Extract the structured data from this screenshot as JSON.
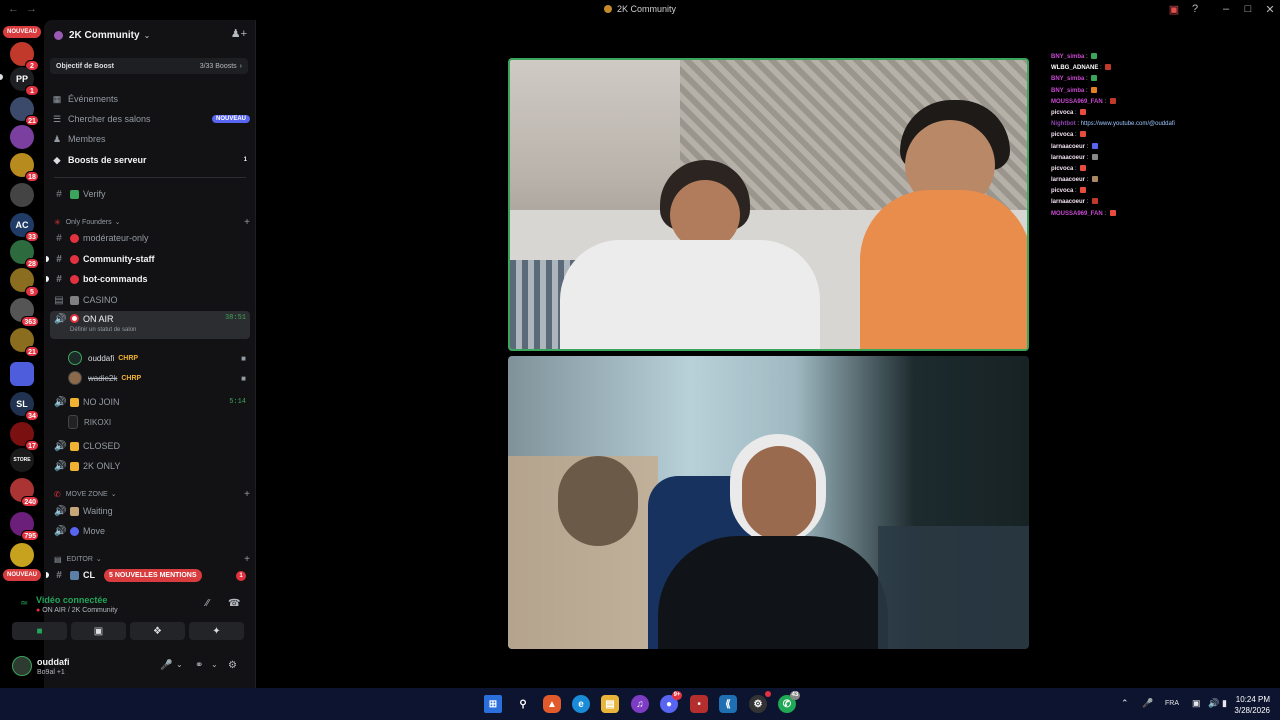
{
  "window": {
    "title": "2K Community"
  },
  "rail": {
    "new_label": "NOUVEAU",
    "servers": [
      {
        "label": "",
        "badge": "2",
        "color": "#c0392b"
      },
      {
        "label": "PP",
        "badge": "1",
        "color": "#1e1f22"
      },
      {
        "label": "",
        "badge": "21",
        "color": "#3b4a6b"
      },
      {
        "label": "",
        "badge": "",
        "color": "#7b3fa0"
      },
      {
        "label": "",
        "badge": "18",
        "color": "#b88b1e"
      },
      {
        "label": "",
        "badge": "",
        "color": "#444"
      },
      {
        "label": "AC",
        "badge": "33",
        "color": "#1f3b66"
      },
      {
        "label": "",
        "badge": "28",
        "color": "#2d6a3e"
      },
      {
        "label": "",
        "badge": "5",
        "color": "#8a6d1f"
      },
      {
        "label": "",
        "badge": "363",
        "color": "#555"
      },
      {
        "label": "",
        "badge": "21",
        "color": "#8a6d1f"
      },
      {
        "label": "",
        "badge": "",
        "color": "#4e5ddb"
      },
      {
        "label": "SL",
        "badge": "34",
        "color": "#20324f"
      },
      {
        "label": "",
        "badge": "17",
        "color": "#7a1010"
      },
      {
        "label": "STORE",
        "badge": "",
        "color": "#1a1a1a"
      },
      {
        "label": "",
        "badge": "240",
        "color": "#a33"
      },
      {
        "label": "",
        "badge": "795",
        "color": "#6b1f7a"
      },
      {
        "label": "",
        "badge": "",
        "color": "#c7a21e"
      }
    ]
  },
  "sidebar": {
    "server_name": "2K Community",
    "boost_goal": "Objectif de Boost",
    "boost_count": "3/33 Boosts",
    "menu": [
      {
        "label": "Événements",
        "icon": "calendar-icon"
      },
      {
        "label": "Chercher des salons",
        "icon": "search-channels-icon",
        "pill": "NOUVEAU"
      },
      {
        "label": "Membres",
        "icon": "members-icon"
      },
      {
        "label": "Boosts de serveur",
        "icon": "boost-icon",
        "count": "1"
      }
    ],
    "verify": "Verify",
    "cat_founders": "Only Founders",
    "ch_moderator": "modérateur-only",
    "ch_staff": "Community-staff",
    "ch_bot": "bot-commands",
    "ch_casino": "CASINO",
    "ch_onair": "ON AIR",
    "onair_timer": "38:51",
    "onair_sub": "Définir un statut de salon",
    "user1": "ouddafi",
    "user1_tag": "CHRP",
    "user2": "wadie2k",
    "user2_tag": "CHRP",
    "ch_nojoin": "NO JOIN",
    "nojoin_timer": "5:14",
    "user3": "RIKOXI",
    "ch_closed": "CLOSED",
    "ch_2konly": "2K ONLY",
    "cat_move": "MOVE ZONE",
    "ch_waiting": "Waiting",
    "ch_move": "Move",
    "cat_editor": "EDITOR",
    "ch_cl": "CL",
    "mentions": "5 NOUVELLES MENTIONS",
    "mentions_count": "1"
  },
  "voice": {
    "status": "Vidéo connectée",
    "location": "ON AIR / 2K Community"
  },
  "user": {
    "name": "ouddafi",
    "status": "Bo9al +1"
  },
  "chat": [
    {
      "author": "BNY_simba",
      "text": "",
      "color": "#c94bd1",
      "emote": "#3ba55c"
    },
    {
      "author": "WLBG_ADNANE",
      "text": "",
      "color": "#ffffff",
      "emote": "#c0392b"
    },
    {
      "author": "BNY_simba",
      "text": "",
      "color": "#c94bd1",
      "emote": "#3ba55c"
    },
    {
      "author": "BNY_simba",
      "text": "",
      "color": "#c94bd1",
      "emote": "#e67e22"
    },
    {
      "author": "MOUSSA969_FAN",
      "text": "",
      "color": "#c94bd1",
      "emote": "#c0392b"
    },
    {
      "author": "picvoca",
      "text": "",
      "color": "#f0e0f0",
      "emote": "#e74c3c"
    },
    {
      "author": "Nightbot",
      "text": "https://www.youtube.com/@ouddafi",
      "color": "#8e44ad",
      "emote": ""
    },
    {
      "author": "picvoca",
      "text": "",
      "color": "#f0e0f0",
      "emote": "#e74c3c"
    },
    {
      "author": "larnaacoeur",
      "text": "",
      "color": "#f0e0f0",
      "emote": "#5865f2"
    },
    {
      "author": "larnaacoeur",
      "text": "",
      "color": "#f0e0f0",
      "emote": "#888888"
    },
    {
      "author": "picvoca",
      "text": "",
      "color": "#f0e0f0",
      "emote": "#e74c3c"
    },
    {
      "author": "larnaacoeur",
      "text": "",
      "color": "#f0e0f0",
      "emote": "#aa8866"
    },
    {
      "author": "picvoca",
      "text": "",
      "color": "#f0e0f0",
      "emote": "#e74c3c"
    },
    {
      "author": "larnaacoeur",
      "text": "",
      "color": "#f0e0f0",
      "emote": "#c0392b"
    },
    {
      "author": "MOUSSA969_FAN",
      "text": "",
      "color": "#c94bd1",
      "emote": "#e74c3c"
    }
  ],
  "taskbar": {
    "discord_badge": "9+",
    "whatsapp_badge": "43",
    "lang": "FRA",
    "time": "10:24 PM",
    "date": "3/28/2026"
  }
}
